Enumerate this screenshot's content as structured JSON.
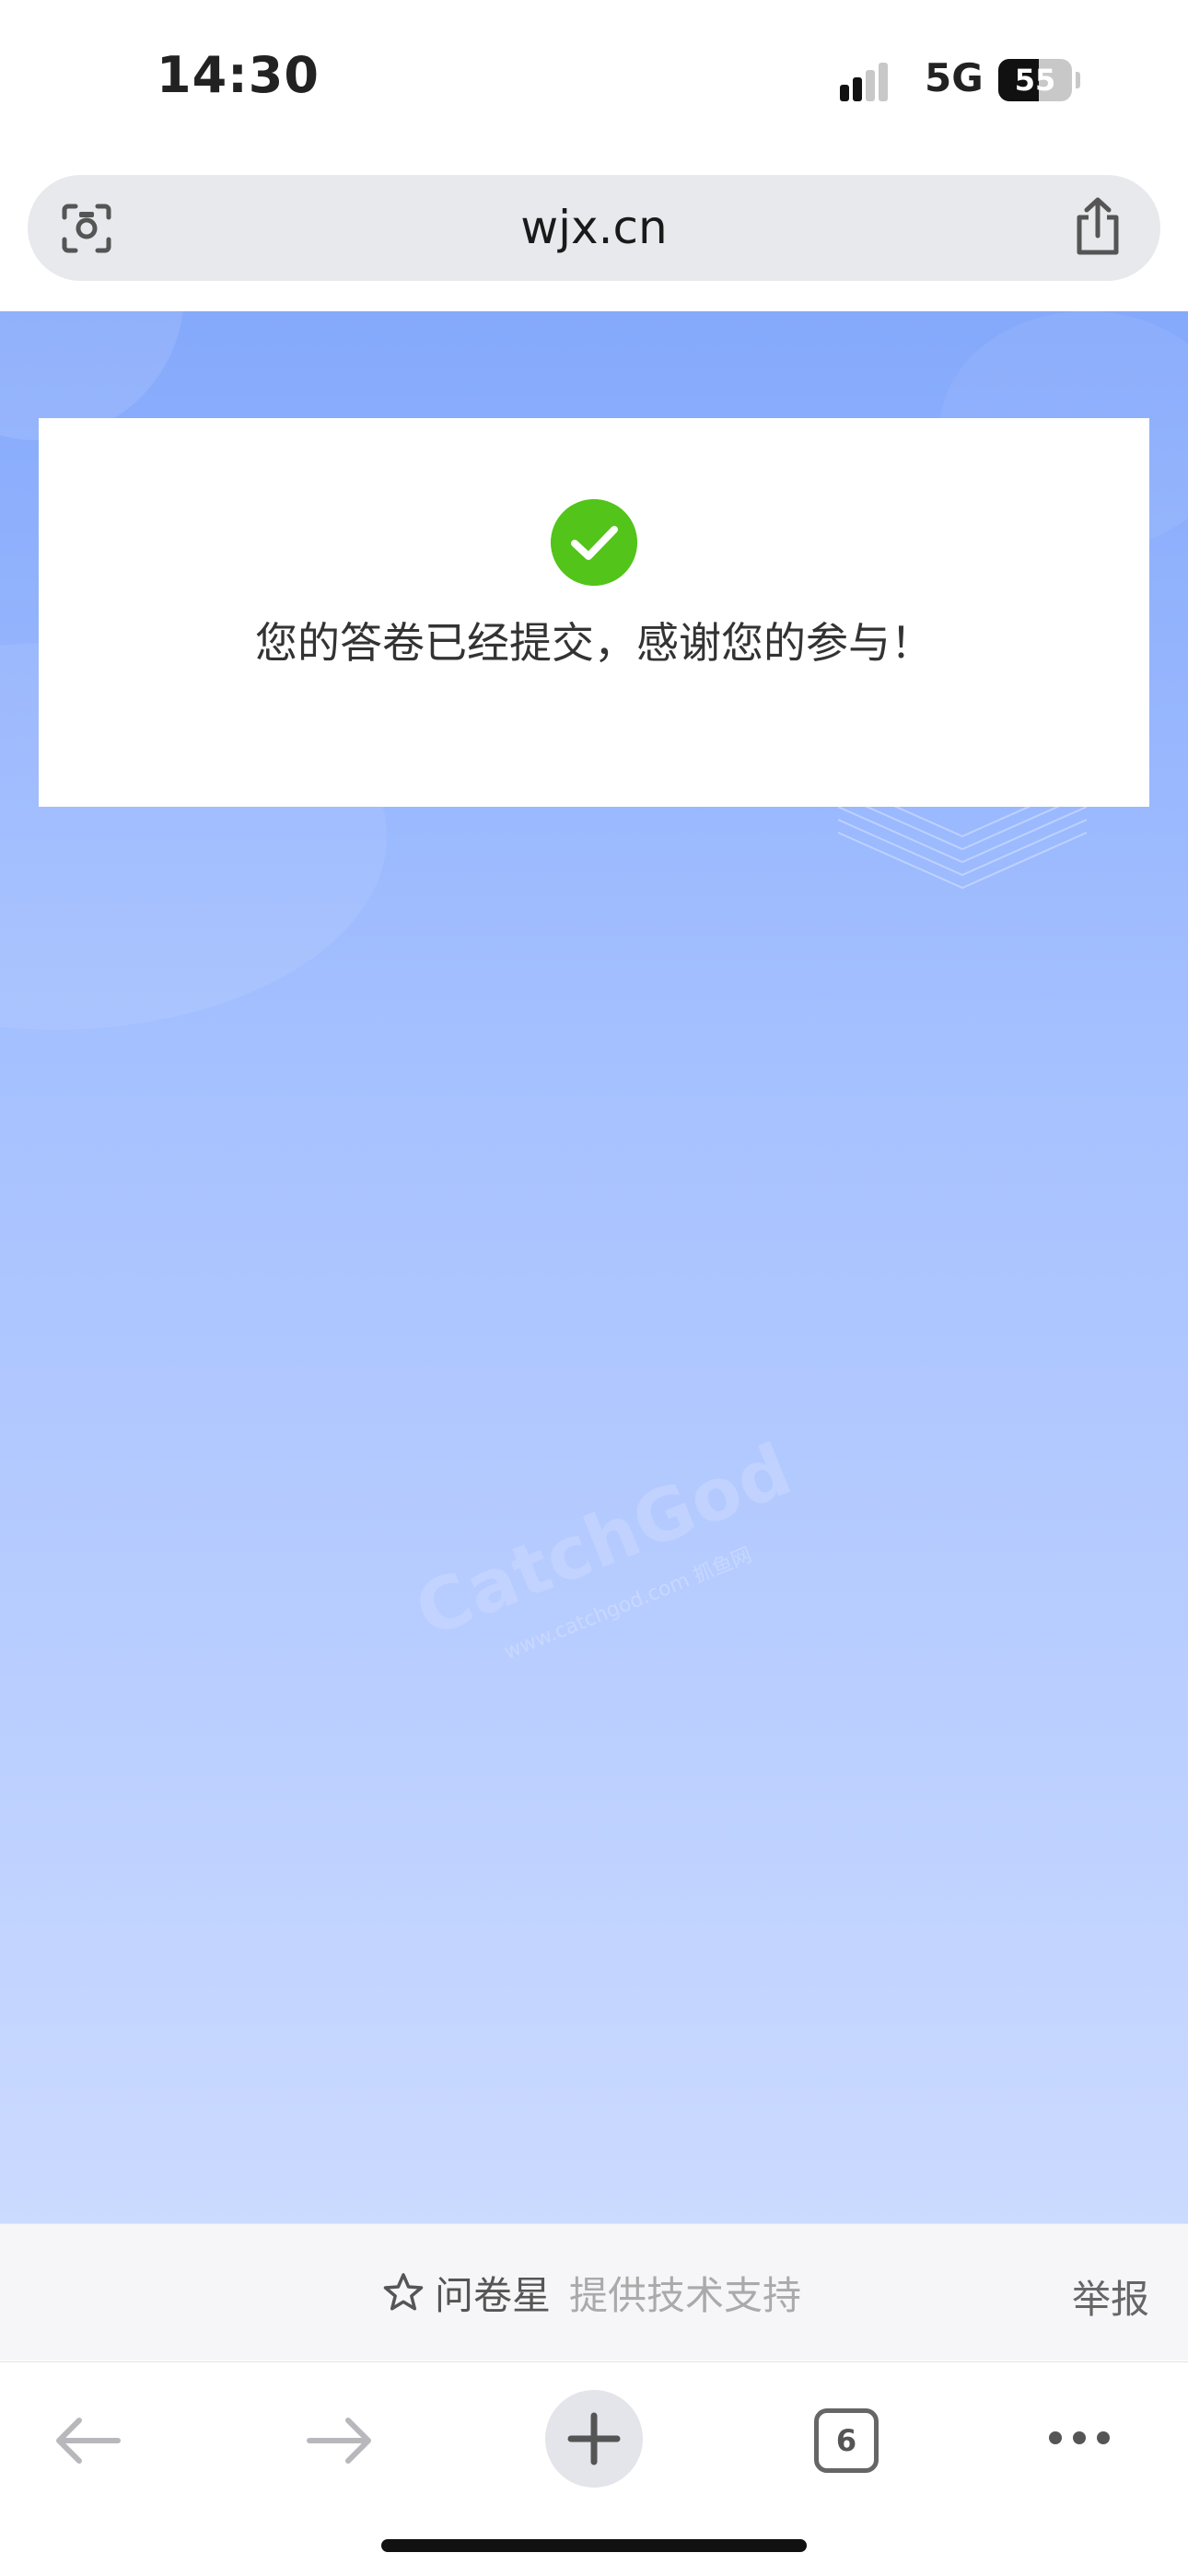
{
  "status_bar": {
    "time": "14:30",
    "network": "5G",
    "battery": "55",
    "battery_level": 0.55
  },
  "address_bar": {
    "url": "wjx.cn",
    "left_icon": "scan-icon",
    "right_icon": "share-icon"
  },
  "result": {
    "message": "您的答卷已经提交，感谢您的参与！",
    "icon": "check-circle-icon",
    "color": "#52c41a"
  },
  "watermark": {
    "text": "CatchGod",
    "subtext": "www.catchgod.com 抓鱼网"
  },
  "footer": {
    "brand": "问卷星",
    "support": "提供技术支持",
    "report": "举报"
  },
  "toolbar": {
    "tabs_count": "6"
  },
  "colors": {
    "bg_top": "#85a9fb",
    "bg_bottom": "#cbdaff"
  }
}
